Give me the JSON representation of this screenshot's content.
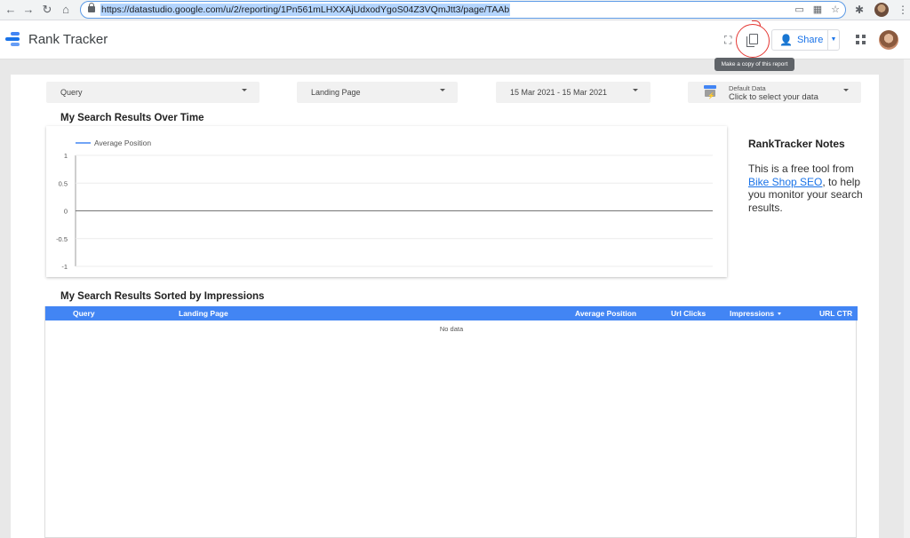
{
  "browser": {
    "url": "https://datastudio.google.com/u/2/reporting/1Pn561mLHXXAjUdxodYgoS04Z3VQmJtt3/page/TAAb",
    "icons": [
      "back-icon",
      "forward-icon",
      "reload-icon",
      "home-icon",
      "lock-icon",
      "cast-icon",
      "qr-icon",
      "bookmark-star-icon",
      "extensions-icon",
      "profile-avatar",
      "menu-dots-icon"
    ]
  },
  "header": {
    "app_title": "Rank Tracker",
    "share_label": "Share",
    "copy_tooltip": "Make a copy of this report"
  },
  "controls": {
    "query": "Query",
    "landing_page": "Landing Page",
    "date_range": "15 Mar 2021 - 15 Mar 2021",
    "data_source_title": "Default Data",
    "data_source_hint": "Click to select your data"
  },
  "chart_section": {
    "title": "My Search Results Over Time"
  },
  "chart_data": {
    "type": "line",
    "title": "",
    "series": [
      {
        "name": "Average Position",
        "values": []
      }
    ],
    "y_ticks": [
      "1",
      "0.5",
      "0",
      "-0.5",
      "-1"
    ],
    "ylim": [
      -1,
      1
    ],
    "xlabel": "",
    "ylabel": "",
    "grid": true,
    "legend": "top-left",
    "colors": {
      "series": "#4285f4"
    }
  },
  "notes": {
    "title": "RankTracker Notes",
    "text_before": "This is a free tool from ",
    "link": "Bike Shop SEO",
    "text_after": ", to help you monitor your search results."
  },
  "table_section": {
    "title": "My Search Results Sorted by Impressions",
    "columns": {
      "query": "Query",
      "landing_page": "Landing Page",
      "avg_position": "Average Position",
      "url_clicks": "Url Clicks",
      "impressions": "Impressions",
      "url_ctr": "URL CTR"
    },
    "empty_text": "No data"
  },
  "colors": {
    "accent": "#4285f4",
    "annotation": "#e53935"
  }
}
